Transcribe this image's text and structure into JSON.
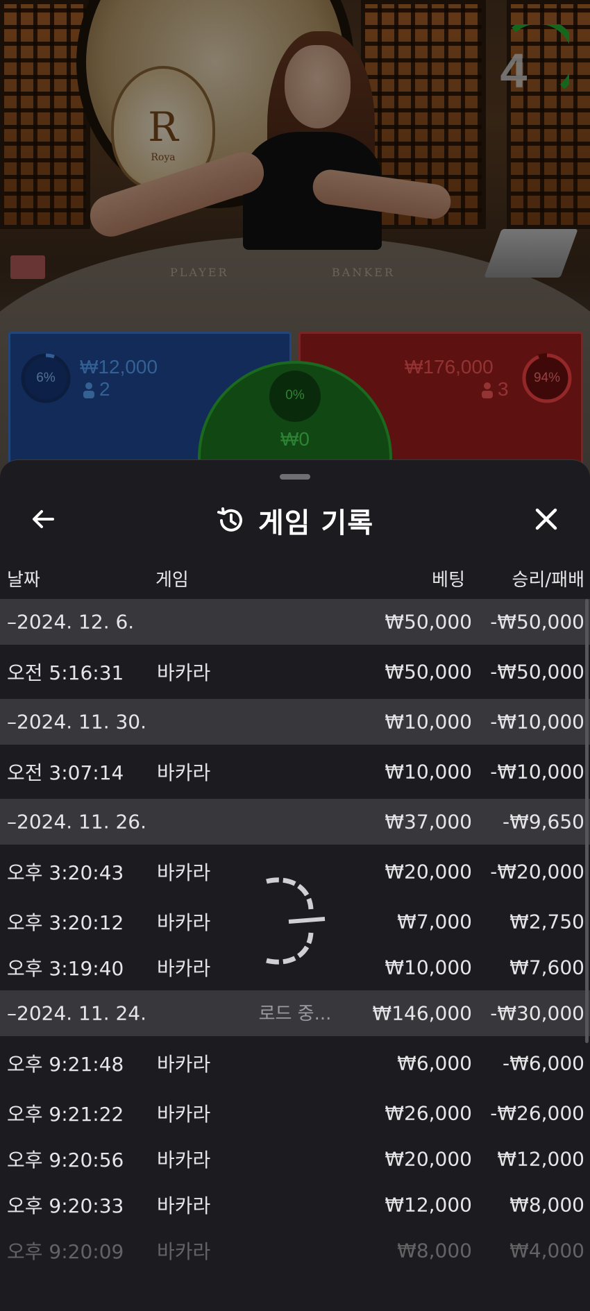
{
  "game": {
    "countdown": "4",
    "table_labels": {
      "player": "PLAYER",
      "banker": "BANKER"
    },
    "crest_letter": "R",
    "crest_sub": "Roya"
  },
  "bets": {
    "player": {
      "percent": "6%",
      "amount": "₩12,000",
      "count": "2",
      "color": "#3b78d6"
    },
    "tie": {
      "percent": "0%",
      "amount": "₩0",
      "color": "#2db536"
    },
    "banker": {
      "percent": "94%",
      "amount": "₩176,000",
      "count": "3",
      "color": "#d04040"
    }
  },
  "sheet": {
    "title": "게임 기록",
    "icons": {
      "back": "arrow-left-icon",
      "title": "history-icon",
      "close": "close-icon"
    },
    "columns": {
      "date": "날짜",
      "game": "게임",
      "bet": "베팅",
      "result": "승리/패배"
    },
    "rows": [
      {
        "type": "date",
        "date": "–2024. 12. 6.",
        "bet": "₩50,000",
        "result": "-₩50,000"
      },
      {
        "type": "game",
        "time": "오전 5:16:31",
        "game": "바카라",
        "bet": "₩50,000",
        "result": "-₩50,000",
        "tall": true
      },
      {
        "type": "date",
        "date": "–2024. 11. 30.",
        "bet": "₩10,000",
        "result": "-₩10,000"
      },
      {
        "type": "game",
        "time": "오전 3:07:14",
        "game": "바카라",
        "bet": "₩10,000",
        "result": "-₩10,000",
        "tall": true
      },
      {
        "type": "date",
        "date": "–2024. 11. 26.",
        "bet": "₩37,000",
        "result": "-₩9,650"
      },
      {
        "type": "game",
        "time": "오후 3:20:43",
        "game": "바카라",
        "bet": "₩20,000",
        "result": "-₩20,000",
        "tall": true
      },
      {
        "type": "game",
        "time": "오후 3:20:12",
        "game": "바카라",
        "bet": "₩7,000",
        "result": "₩2,750"
      },
      {
        "type": "game",
        "time": "오후 3:19:40",
        "game": "바카라",
        "bet": "₩10,000",
        "result": "₩7,600"
      },
      {
        "type": "date",
        "date": "–2024. 11. 24.",
        "bet": "₩146,000",
        "result": "-₩30,000"
      },
      {
        "type": "game",
        "time": "오후 9:21:48",
        "game": "바카라",
        "bet": "₩6,000",
        "result": "-₩6,000",
        "tall": true
      },
      {
        "type": "game",
        "time": "오후 9:21:22",
        "game": "바카라",
        "bet": "₩26,000",
        "result": "-₩26,000"
      },
      {
        "type": "game",
        "time": "오후 9:20:56",
        "game": "바카라",
        "bet": "₩20,000",
        "result": "₩12,000"
      },
      {
        "type": "game",
        "time": "오후 9:20:33",
        "game": "바카라",
        "bet": "₩12,000",
        "result": "₩8,000"
      },
      {
        "type": "game",
        "time": "오후 9:20:09",
        "game": "바카라",
        "bet": "₩8,000",
        "result": "₩4,000",
        "fade": true
      }
    ],
    "loading_text": "로드 중..."
  }
}
